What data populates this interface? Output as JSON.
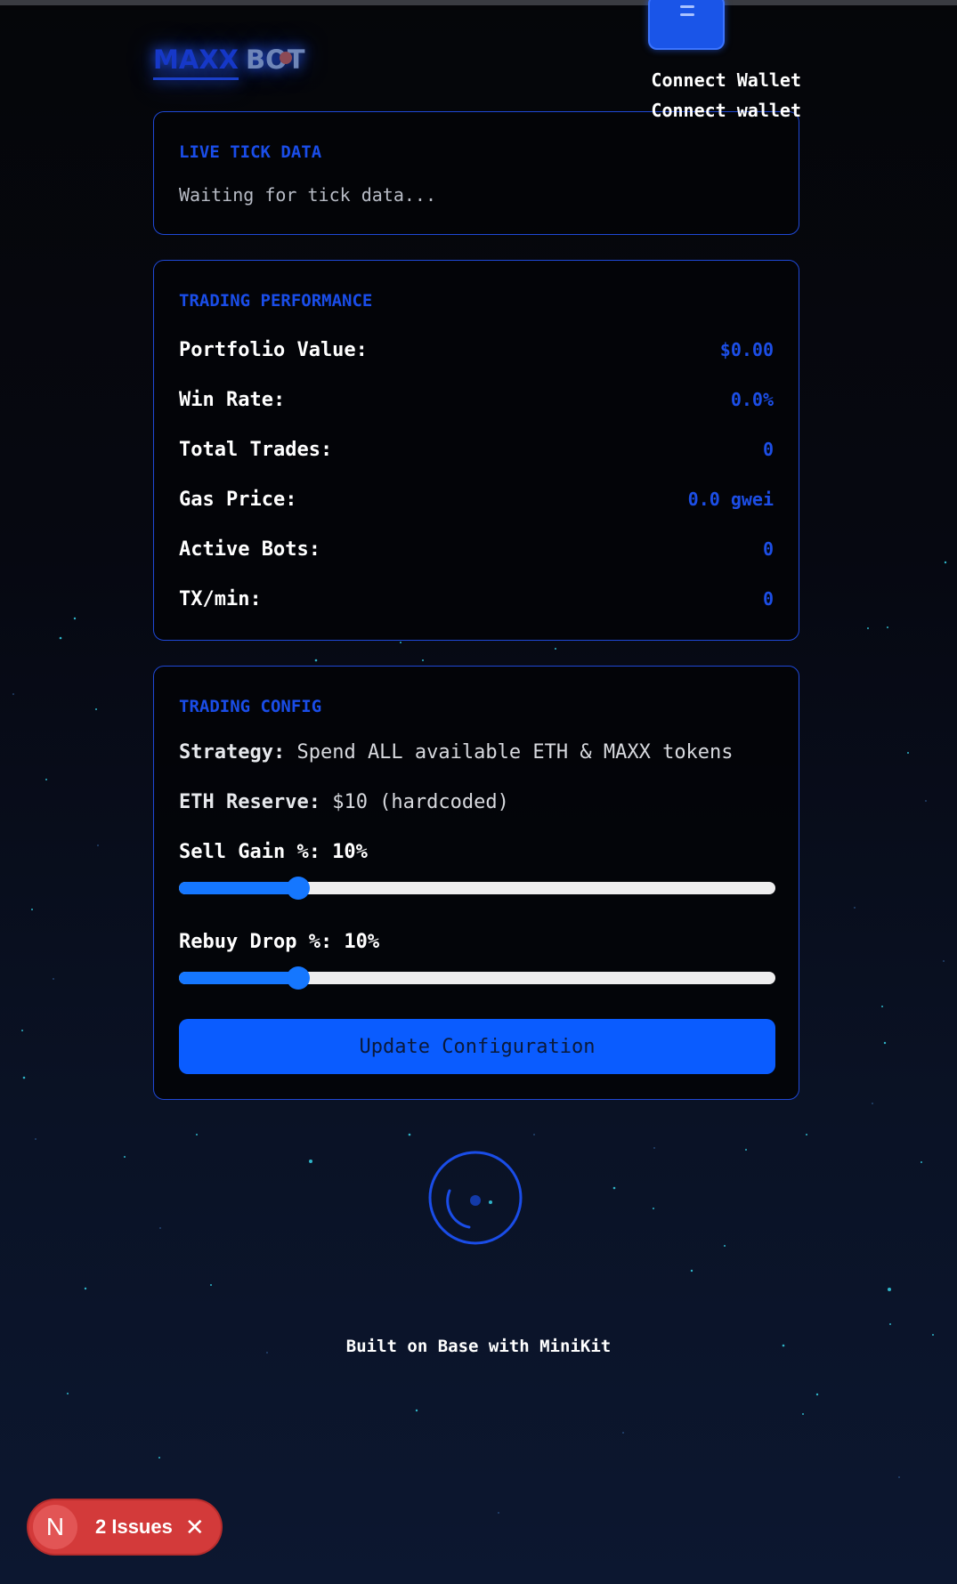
{
  "header": {
    "logo_part1": "MAXX",
    "logo_part2": "BOT",
    "wallet_button_label": "Connect Wallet",
    "wallet_status_label": "Connect wallet"
  },
  "live_tick": {
    "title": "LIVE TICK DATA",
    "status": "Waiting for tick data..."
  },
  "performance": {
    "title": "TRADING PERFORMANCE",
    "rows": [
      {
        "label": "Portfolio Value:",
        "value": "$0.00"
      },
      {
        "label": "Win Rate:",
        "value": "0.0%"
      },
      {
        "label": "Total Trades:",
        "value": "0"
      },
      {
        "label": "Gas Price:",
        "value": "0.0 gwei"
      },
      {
        "label": "Active Bots:",
        "value": "0"
      },
      {
        "label": "TX/min:",
        "value": "0"
      }
    ]
  },
  "config": {
    "title": "TRADING CONFIG",
    "strategy_label": "Strategy:",
    "strategy_value": "Spend ALL available ETH & MAXX tokens",
    "reserve_label": "ETH Reserve:",
    "reserve_value": "$10 (hardcoded)",
    "sell_gain_label": "Sell Gain %: 10%",
    "sell_gain_fraction": 0.2,
    "rebuy_drop_label": "Rebuy Drop %: 10%",
    "rebuy_drop_fraction": 0.2,
    "update_button": "Update Configuration"
  },
  "footer": {
    "text": "Built on Base with MiniKit"
  },
  "dev_overlay": {
    "badge_letter": "N",
    "issues_label": "2 Issues",
    "close_symbol": "✕"
  },
  "colors": {
    "accent": "#1a4de8",
    "slider": "#1577ff",
    "button": "#0a5cff",
    "issues": "#d33a3a"
  }
}
